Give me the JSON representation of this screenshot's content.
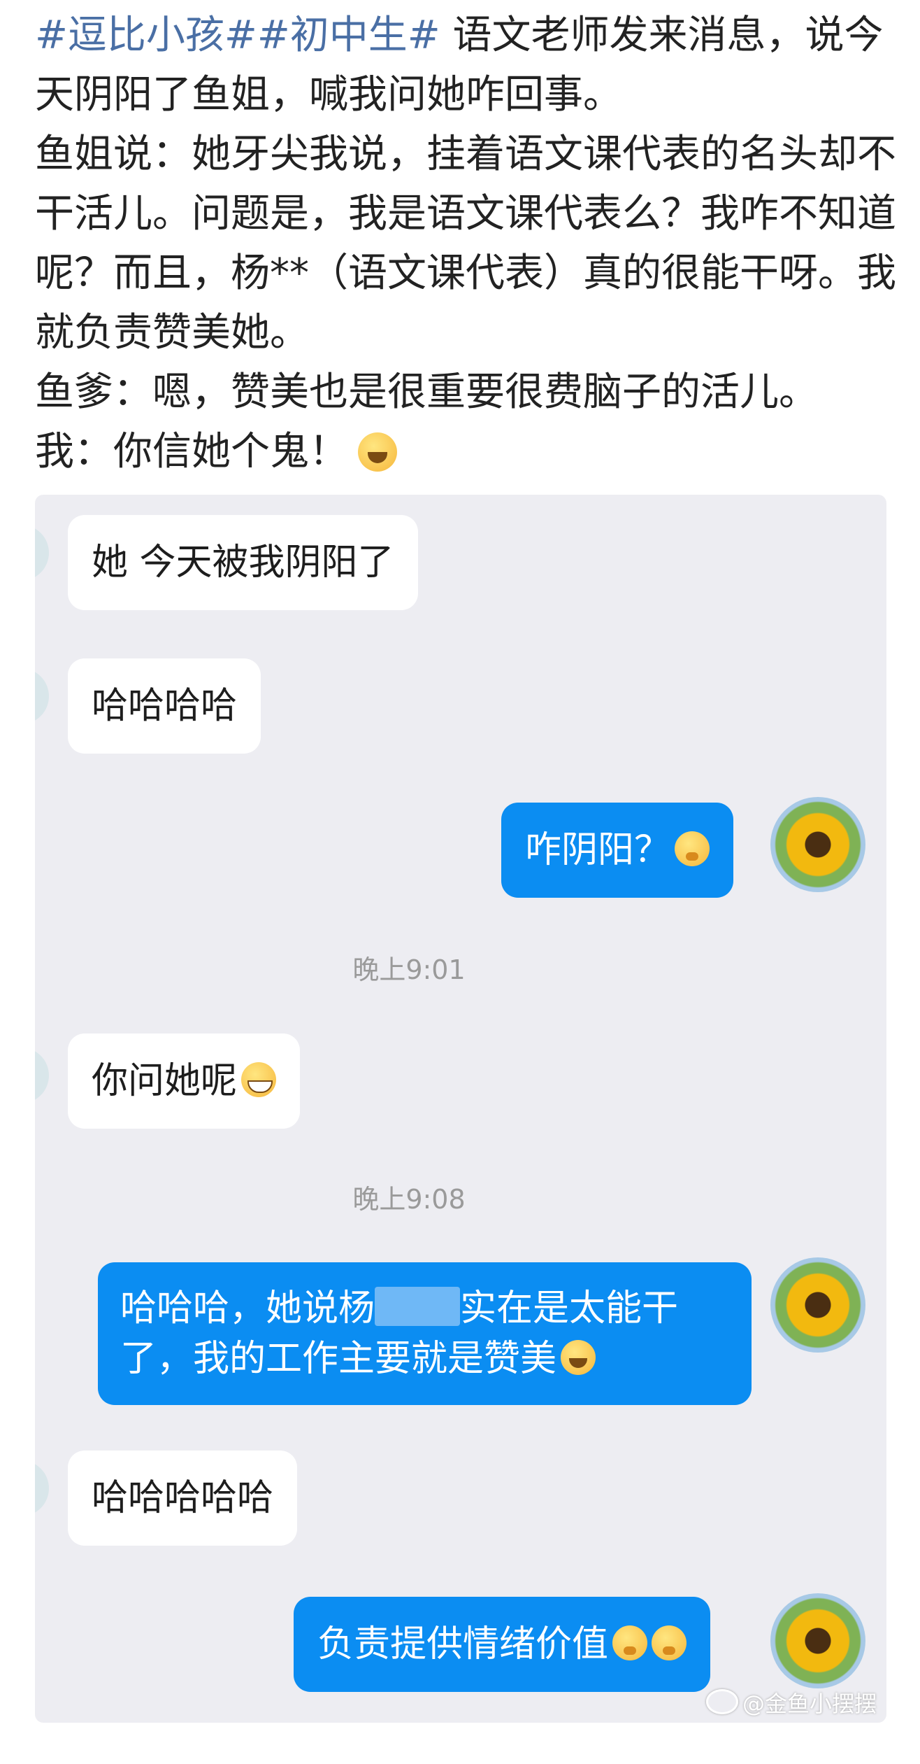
{
  "post": {
    "tag1": "#逗比小孩#",
    "tag2": "#初中生#",
    "line1_rest": " 语文老师发来消息，说今天阴阳了鱼姐，喊我问她咋回事。",
    "line2": "鱼姐说：她牙尖我说，挂着语文课代表的名头却不干活儿。问题是，我是语文课代表么？我咋不知道呢？而且，杨**（语文课代表）真的很能干呀。我就负责赞美她。",
    "line3": "鱼爹：嗯，赞美也是很重要很费脑子的活儿。",
    "line4": "我：你信她个鬼！",
    "line4_emoji": "laugh-cry-emoji"
  },
  "chat": {
    "messages": [
      {
        "side": "left",
        "text": "她 今天被我阴阳了"
      },
      {
        "side": "left",
        "text": "哈哈哈哈"
      },
      {
        "side": "right",
        "text": "咋阴阳？"
      },
      {
        "timestamp": "晚上9:01"
      },
      {
        "side": "left",
        "text": "你问她呢"
      },
      {
        "timestamp": "晚上9:08"
      },
      {
        "side": "right",
        "text_a": "哈哈哈，她说杨",
        "text_b": "实在是太能干",
        "text_c": "了，我的工作主要就是赞美"
      },
      {
        "side": "left",
        "text": "哈哈哈哈哈"
      },
      {
        "side": "right",
        "text": "负责提供情绪价值"
      }
    ],
    "avatar": "sunflower-avatar"
  },
  "watermark": "@金鱼小摆摆",
  "colors": {
    "tag": "#4a6fa5",
    "chat_bg": "#ededf2",
    "bubble_right": "#0b8df2",
    "bubble_left": "#ffffff",
    "timestamp": "#9a9a9a"
  }
}
